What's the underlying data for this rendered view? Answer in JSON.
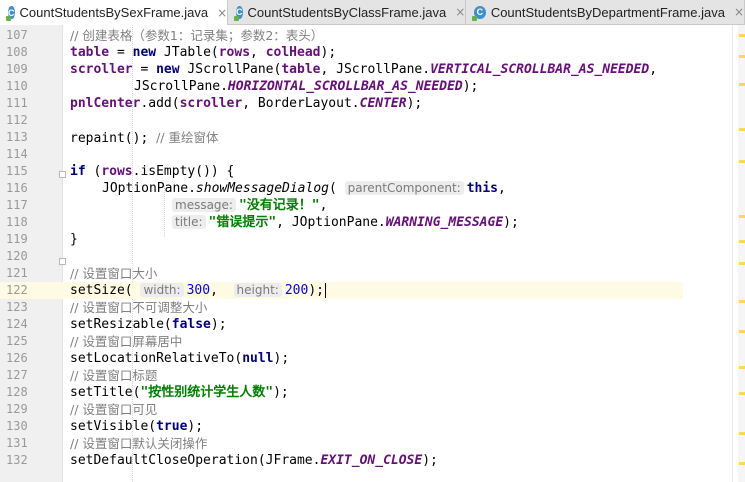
{
  "tabs": [
    {
      "label": "CountStudentsBySexFrame.java",
      "active": true
    },
    {
      "label": "CountStudentsByClassFrame.java",
      "active": false
    },
    {
      "label": "CountStudentsByDepartmentFrame.java",
      "active": false
    }
  ],
  "tab_close_glyph": "×",
  "line_numbers": [
    "107",
    "108",
    "109",
    "110",
    "111",
    "112",
    "113",
    "114",
    "115",
    "116",
    "117",
    "118",
    "119",
    "120",
    "121",
    "122",
    "123",
    "124",
    "125",
    "126",
    "127",
    "128",
    "129",
    "130",
    "131",
    "132"
  ],
  "current_line": "122",
  "code": {
    "l107_comment": "// 创建表格（参数1：记录集；参数2：表头）",
    "l108_kw": "table",
    "l108_new": "new",
    "l108_rest": " JTable(",
    "l108_rows": "rows",
    "l108_comma": ", ",
    "l108_colhead": "colHead",
    "l108_end": ");",
    "l109_scroller": "scroller",
    "l109_new": "new",
    "l109_rest": " JScrollPane(",
    "l109_table": "table",
    "l109_mid": ", JScrollPane.",
    "l109_const": "VERTICAL_SCROLLBAR_AS_NEEDED",
    "l109_end": ",",
    "l110_prefix": "JScrollPane.",
    "l110_const": "HORIZONTAL_SCROLLBAR_AS_NEEDED",
    "l110_end": ");",
    "l111_pnl": "pnlCenter",
    "l111_mid": ".add(",
    "l111_scroller": "scroller",
    "l111_mid2": ", BorderLayout.",
    "l111_const": "CENTER",
    "l111_end": ");",
    "l113_code": "repaint(); ",
    "l113_comment": "// 重绘窗体",
    "l115_if": "if",
    "l115_open": " (",
    "l115_rows": "rows",
    "l115_rest": ".isEmpty()) {",
    "l116_class": "JOptionPane.",
    "l116_method": "showMessageDialog",
    "l116_paren": "(",
    "l116_hint": "parentComponent:",
    "l116_this": "this",
    "l116_end": ",",
    "l117_hint": "message:",
    "l117_str": "\"没有记录！\"",
    "l117_end": ",",
    "l118_hint": "title:",
    "l118_str": "\"错误提示\"",
    "l118_mid": ", JOptionPane.",
    "l118_const": "WARNING_MESSAGE",
    "l118_end": ");",
    "l119_code": "}",
    "l121_comment": "// 设置窗口大小",
    "l122_method": "setSize(",
    "l122_hint_w": "width:",
    "l122_w": "300",
    "l122_comma": ", ",
    "l122_hint_h": "height:",
    "l122_h": "200",
    "l122_end": ");",
    "l123_comment": "// 设置窗口不可调整大小",
    "l124_method": "setResizable(",
    "l124_val": "false",
    "l124_end": ");",
    "l125_comment": "// 设置窗口屏幕居中",
    "l126_method": "setLocationRelativeTo(",
    "l126_val": "null",
    "l126_end": ");",
    "l127_comment": "// 设置窗口标题",
    "l128_method": "setTitle(",
    "l128_str": "\"按性别统计学生人数\"",
    "l128_end": ");",
    "l129_comment": "// 设置窗口可见",
    "l130_method": "setVisible(",
    "l130_val": "true",
    "l130_end": ");",
    "l131_comment": "// 设置窗口默认关闭操作",
    "l132_method": "setDefaultCloseOperation(JFrame.",
    "l132_const": "EXIT_ON_CLOSE",
    "l132_end": ");"
  },
  "colors": {
    "keyword": "#000080",
    "field": "#660e7a",
    "comment": "#808080",
    "string": "#008000",
    "number": "#0000ff",
    "current_line_bg": "#fffae3"
  },
  "icons": {
    "tab_file": "java-class-icon",
    "fold": "fold-marker-icon"
  }
}
